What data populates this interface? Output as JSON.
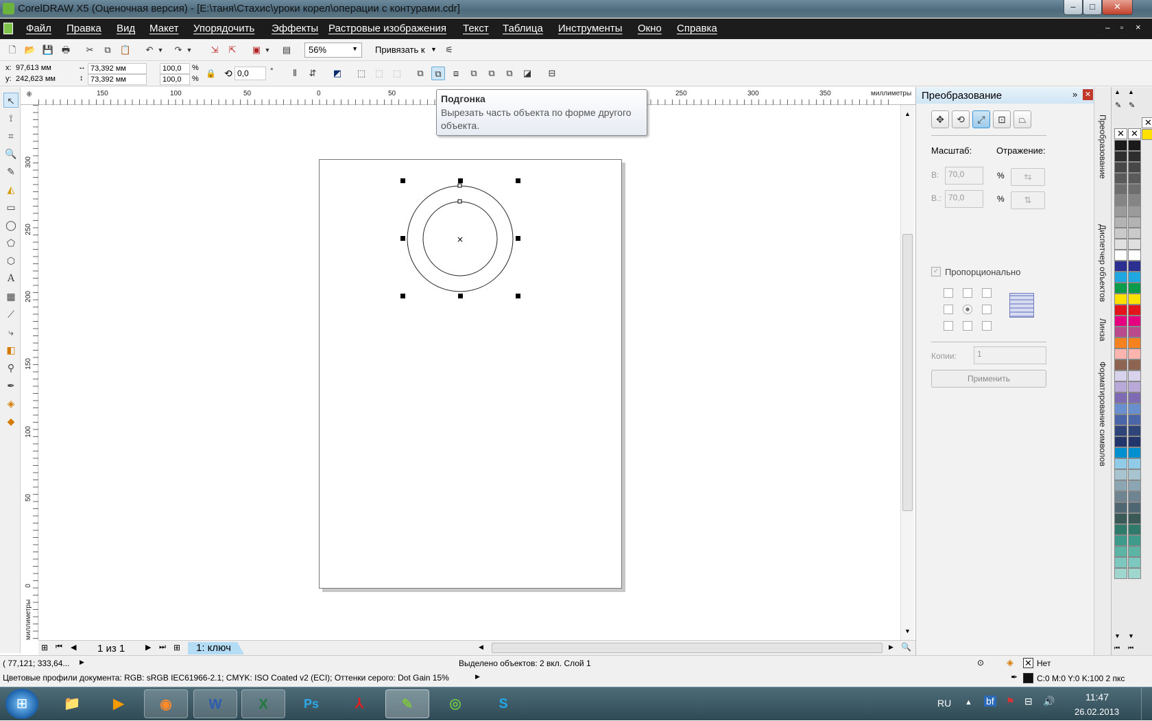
{
  "window": {
    "title": "CorelDRAW X5 (Оценочная версия) - [E:\\таня\\Стахис\\уроки корел\\операции с контурами.cdr]",
    "minimize": "–",
    "maximize": "□",
    "close": "✕"
  },
  "menu": [
    "Файл",
    "Правка",
    "Вид",
    "Макет",
    "Упорядочить",
    "Эффекты",
    "Растровые изображения",
    "Текст",
    "Таблица",
    "Инструменты",
    "Окно",
    "Справка"
  ],
  "standard_toolbar": {
    "zoom": "56%",
    "snap_label": "Привязать к"
  },
  "property_bar": {
    "x_label": "x:",
    "x_value": "97,613 мм",
    "y_label": "y:",
    "y_value": "242,623 мм",
    "width": "73,392 мм",
    "height": "73,392 мм",
    "scale_x": "100,0",
    "scale_y": "100,0",
    "percent": "%",
    "angle": "0,0",
    "degree": "°"
  },
  "rulers": {
    "h_ticks": [
      "150",
      "100",
      "50",
      "0",
      "50",
      "250",
      "300",
      "350"
    ],
    "v_ticks": [
      "300",
      "250",
      "200",
      "150",
      "100",
      "50",
      "0"
    ],
    "unit": "миллиметры"
  },
  "tooltip": {
    "title": "Подгонка",
    "body": "Вырезать часть объекта по форме другого объекта."
  },
  "page_nav": {
    "page_count": "1 из 1",
    "tab": "1: ключ"
  },
  "docker": {
    "title": "Преобразование",
    "scale_label": "Масштаб:",
    "mirror_label": "Отражение:",
    "w_label": "В:",
    "w_value": "70,0",
    "h_label": "В.:",
    "h_value": "70,0",
    "percent": "%",
    "proportional_label": "Пропорционально",
    "copies_label": "Копии:",
    "copies_value": "1",
    "apply_label": "Применить"
  },
  "side_tabs": [
    "Преобразование",
    "Диспетчер объектов",
    "Линза",
    "Форматирование символов"
  ],
  "palette_colors": [
    "#1a1a1a",
    "#2e2e2e",
    "#474747",
    "#5a5a5a",
    "#6e6e6e",
    "#858585",
    "#9b9b9b",
    "#b3b3b3",
    "#cacaca",
    "#e0e0e0",
    "#ffffff",
    "#2b2f8f",
    "#1fa7e1",
    "#0c9a4b",
    "#ffe100",
    "#e3141b",
    "#e4007f",
    "#b94b8c",
    "#f5821f",
    "#fbb4ae",
    "#8c6450",
    "#d9d2ec",
    "#b8a9d9",
    "#7e6bb4",
    "#6a8fcf",
    "#4a66a8",
    "#2f4479",
    "#22366b",
    "#0090d0",
    "#90cbe8",
    "#a7c4d0",
    "#8ba5b2",
    "#6e8491",
    "#4f6773",
    "#3a5a58",
    "#2f7a6a",
    "#3e9a8a",
    "#5bb4a4",
    "#7cc8be",
    "#9fd6ce"
  ],
  "status": {
    "coords": "( 77,121; 333,64... ",
    "selection": "Выделено объектов: 2 вкл. Слой 1",
    "fill_label": "Нет",
    "color_profiles": "Цветовые профили документа: RGB: sRGB IEC61966-2.1; CMYK: ISO Coated v2 (ECI); Оттенки серого: Dot Gain 15%",
    "outline": "C:0 M:0 Y:0 K:100  2 пкс"
  },
  "taskbar": {
    "lang": "RU",
    "time": "11:47",
    "date": "26.02.2013",
    "apps": [
      "start",
      "explorer",
      "media",
      "firefox",
      "word",
      "excel",
      "photoshop",
      "acrobat",
      "coreldraw",
      "corel-connect",
      "skype"
    ]
  },
  "colors": {
    "menubar": "#1c1c1c",
    "accent": "#3b93d3",
    "tab_active": "#b5dcf5"
  }
}
